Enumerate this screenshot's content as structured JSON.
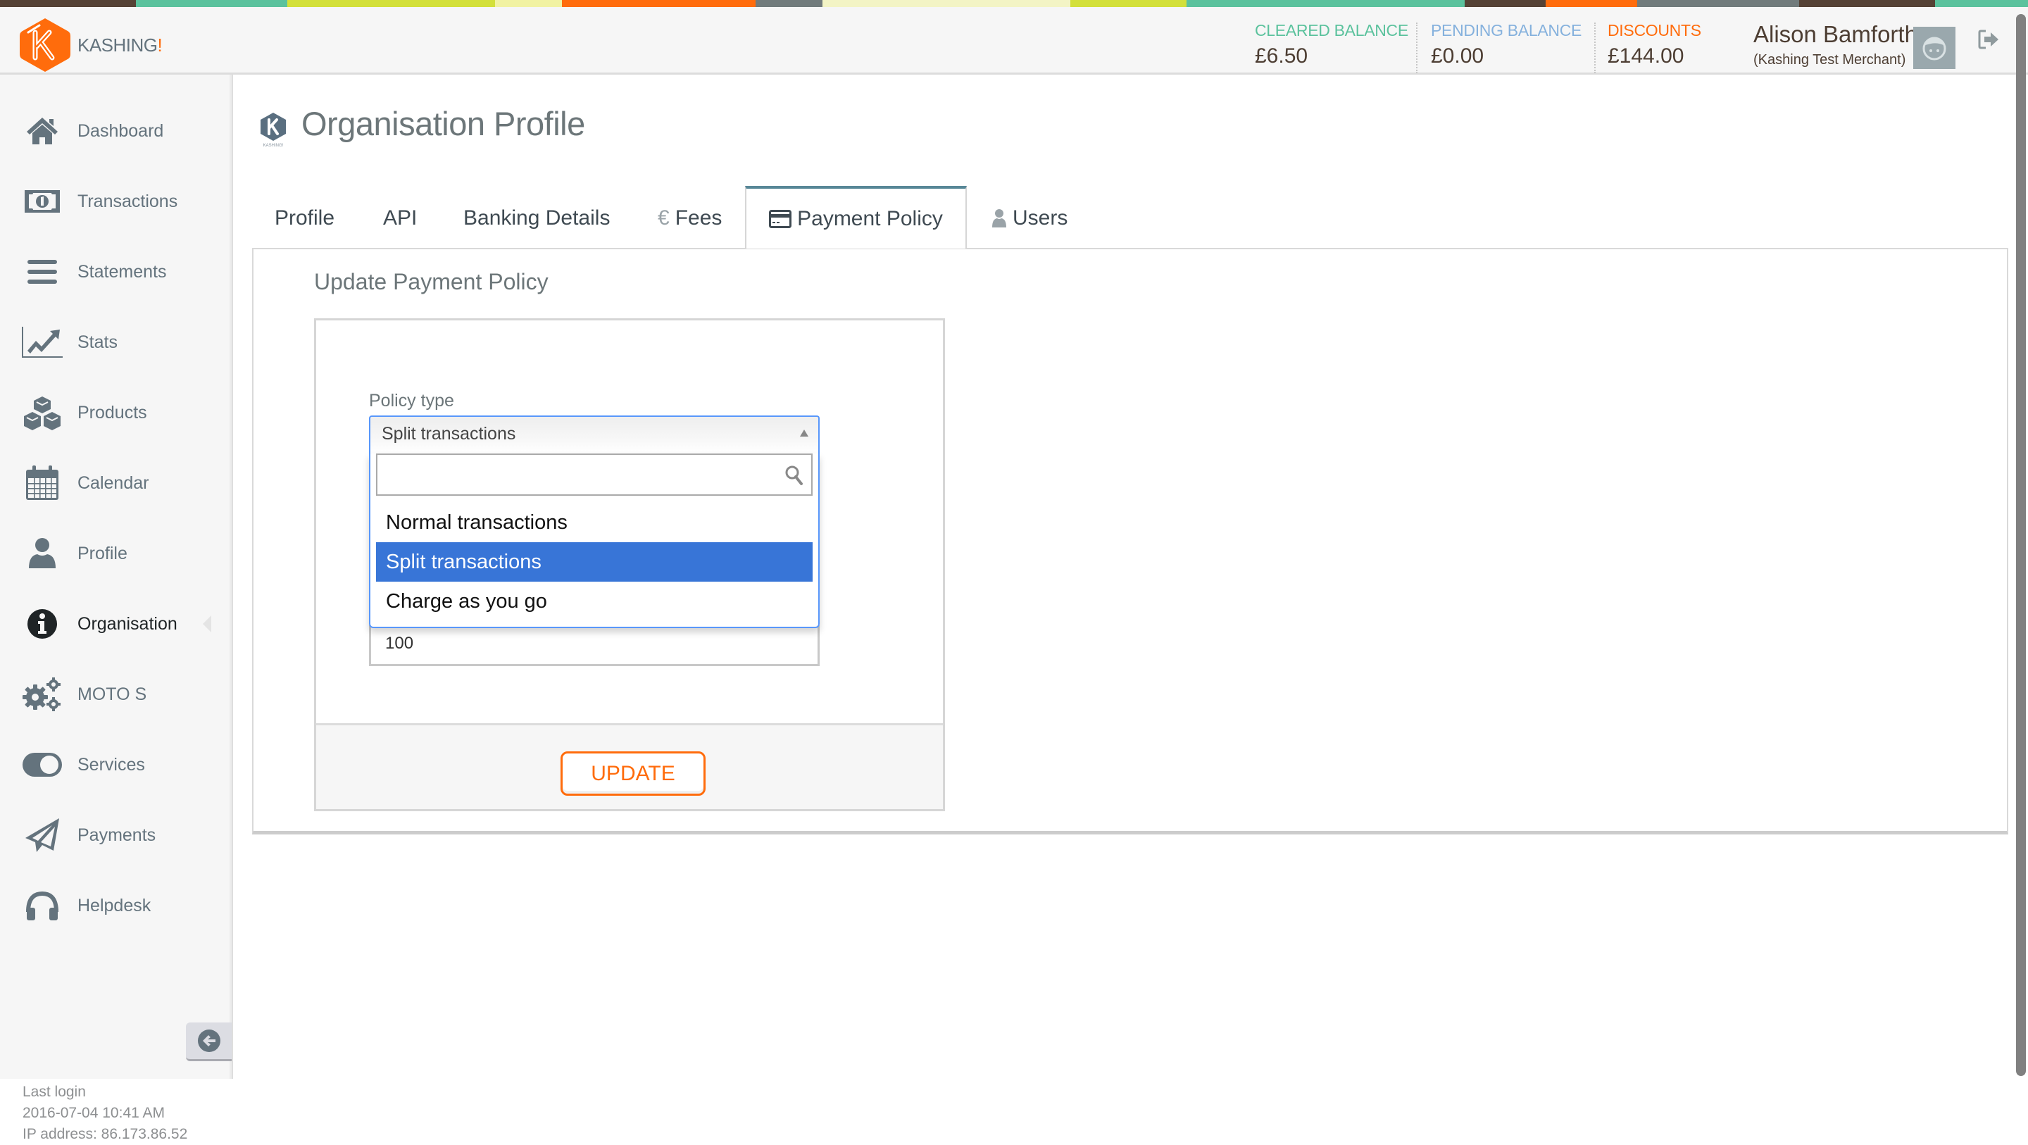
{
  "brand": {
    "name": "KASHING",
    "suffix": "!",
    "accent": "#ff6c0c"
  },
  "top_bar_colors": [
    "#554235",
    "#5bc29d",
    "#d3e03a",
    "#f1f2a2",
    "#ff6c0c",
    "#717b7c",
    "#f3f4c5",
    "#d3e03a",
    "#5bc29d",
    "#554235",
    "#ff6c0c",
    "#717b7c",
    "#554235",
    "#5bc29d"
  ],
  "header": {
    "stats": [
      {
        "label": "CLEARED BALANCE",
        "value": "£6.50",
        "color": "#5bc29d"
      },
      {
        "label": "PENDING BALANCE",
        "value": "£0.00",
        "color": "#85b1dd"
      },
      {
        "label": "DISCOUNTS",
        "value": "£144.00",
        "color": "#ff6c0c"
      }
    ],
    "user": {
      "name": "Alison Bamforth",
      "organisation": "(Kashing Test Merchant)"
    },
    "avatar_icon": "user-avatar-icon",
    "logout_icon": "sign-out-icon"
  },
  "sidebar": {
    "items": [
      {
        "label": "Dashboard",
        "icon": "home-icon"
      },
      {
        "label": "Transactions",
        "icon": "money-bill-icon"
      },
      {
        "label": "Statements",
        "icon": "bars-icon"
      },
      {
        "label": "Stats",
        "icon": "line-chart-icon"
      },
      {
        "label": "Products",
        "icon": "cubes-icon"
      },
      {
        "label": "Calendar",
        "icon": "calendar-icon"
      },
      {
        "label": "Profile",
        "icon": "user-icon"
      },
      {
        "label": "Organisation",
        "icon": "info-circle-icon",
        "active": true
      },
      {
        "label": "MOTO S",
        "icon": "cogs-icon"
      },
      {
        "label": "Services",
        "icon": "toggle-on-icon"
      },
      {
        "label": "Payments",
        "icon": "paper-plane-icon"
      },
      {
        "label": "Helpdesk",
        "icon": "headphones-icon"
      }
    ],
    "collapse_icon": "arrow-circle-left-icon",
    "last_login": {
      "label": "Last login",
      "datetime": "2016-07-04 10:41 AM",
      "ip": "IP address: 86.173.86.52"
    }
  },
  "page": {
    "title": "Organisation Profile",
    "tabs": [
      {
        "label": "Profile"
      },
      {
        "label": "API"
      },
      {
        "label": "Banking Details"
      },
      {
        "label": "Fees",
        "icon": "euro-icon",
        "glyph": "€"
      },
      {
        "label": "Payment Policy",
        "icon": "credit-card-icon",
        "active": true
      },
      {
        "label": "Users",
        "icon": "user-icon"
      }
    ],
    "section_title": "Update Payment Policy",
    "form": {
      "policy_type_label": "Policy type",
      "policy_type_selected": "Split transactions",
      "search_value": "",
      "options": [
        "Normal transactions",
        "Split transactions",
        "Charge as you go"
      ],
      "highlighted_option": "Split transactions",
      "amount_value": "100",
      "update_label": "UPDATE"
    }
  }
}
